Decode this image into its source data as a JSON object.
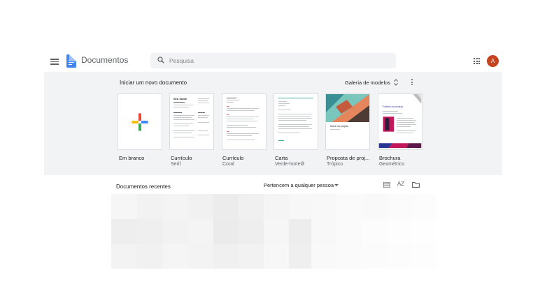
{
  "header": {
    "app_title": "Documentos",
    "search_placeholder": "Pesquisa",
    "avatar_letter": "A"
  },
  "templates": {
    "section_title": "Iniciar um novo documento",
    "gallery_label": "Galeria de modelos",
    "items": [
      {
        "label": "Em branco",
        "sub": ""
      },
      {
        "label": "Currículo",
        "sub": "Serif",
        "title_text": "Seu nome"
      },
      {
        "label": "Currículo",
        "sub": "Coral"
      },
      {
        "label": "Carta",
        "sub": "Verde-hortelã"
      },
      {
        "label": "Proposta de proj...",
        "sub": "Trópico",
        "title_text": "Nome do projeto"
      },
      {
        "label": "Brochura",
        "sub": "Geométrico",
        "title_text": "Folheto do produto"
      }
    ]
  },
  "recent": {
    "title": "Documentos recentes",
    "owner_filter": "Pertencem a qualquer pessoa",
    "sort_label": "AZ"
  },
  "colors": {
    "brand_blue": "#4285f4",
    "avatar": "#c5431e",
    "band": "#f1f3f4",
    "mint": "#3fb391",
    "brochure_accent": "#c2185b"
  }
}
